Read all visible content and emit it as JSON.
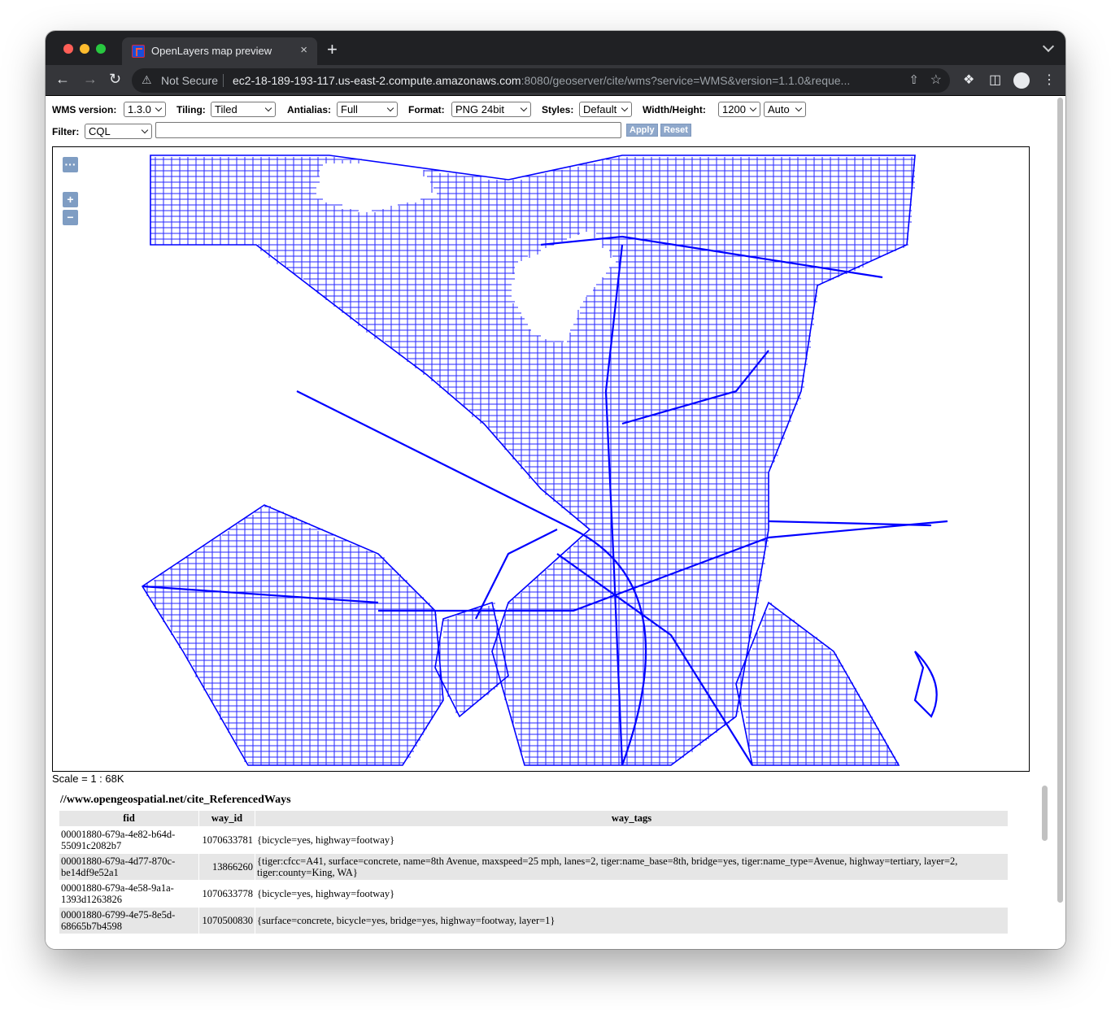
{
  "browser": {
    "tab_title": "OpenLayers map preview",
    "tab_close": "×",
    "new_tab": "+",
    "security_label": "Not Secure",
    "url_host": "ec2-18-189-193-117.us-east-2.compute.amazonaws.com",
    "url_path": ":8080/geoserver/cite/wms?service=WMS&version=1.1.0&reque..."
  },
  "controls": {
    "wms_version_label": "WMS version:",
    "wms_version_value": "1.3.0",
    "tiling_label": "Tiling:",
    "tiling_value": "Tiled",
    "antialias_label": "Antialias:",
    "antialias_value": "Full",
    "format_label": "Format:",
    "format_value": "PNG 24bit",
    "styles_label": "Styles:",
    "styles_value": "Default",
    "size_label": "Width/Height:",
    "width_value": "1200",
    "height_value": "Auto",
    "filter_label": "Filter:",
    "filter_type_value": "CQL",
    "filter_value": "",
    "apply_label": "Apply",
    "reset_label": "Reset"
  },
  "map": {
    "menu_button": "···",
    "zoom_in": "+",
    "zoom_out": "−",
    "line_color": "#0000ff",
    "scale_text": "Scale = 1 : 68K"
  },
  "features": {
    "layer_title": "//www.opengeospatial.net/cite_ReferencedWays",
    "columns": [
      "fid",
      "way_id",
      "way_tags"
    ],
    "rows": [
      {
        "fid": "00001880-679a-4e82-b64d-55091c2082b7",
        "way_id": "1070633781",
        "way_tags": "{bicycle=yes, highway=footway}"
      },
      {
        "fid": "00001880-679a-4d77-870c-be14df9e52a1",
        "way_id": "13866260",
        "way_tags": "{tiger:cfcc=A41, surface=concrete, name=8th Avenue, maxspeed=25 mph, lanes=2, tiger:name_base=8th, bridge=yes, tiger:name_type=Avenue, highway=tertiary, layer=2, tiger:county=King, WA}"
      },
      {
        "fid": "00001880-679a-4e58-9a1a-1393d1263826",
        "way_id": "1070633778",
        "way_tags": "{bicycle=yes, highway=footway}"
      },
      {
        "fid": "00001880-6799-4e75-8e5d-68665b7b4598",
        "way_id": "1070500830",
        "way_tags": "{surface=concrete, bicycle=yes, bridge=yes, highway=footway, layer=1}"
      }
    ]
  }
}
